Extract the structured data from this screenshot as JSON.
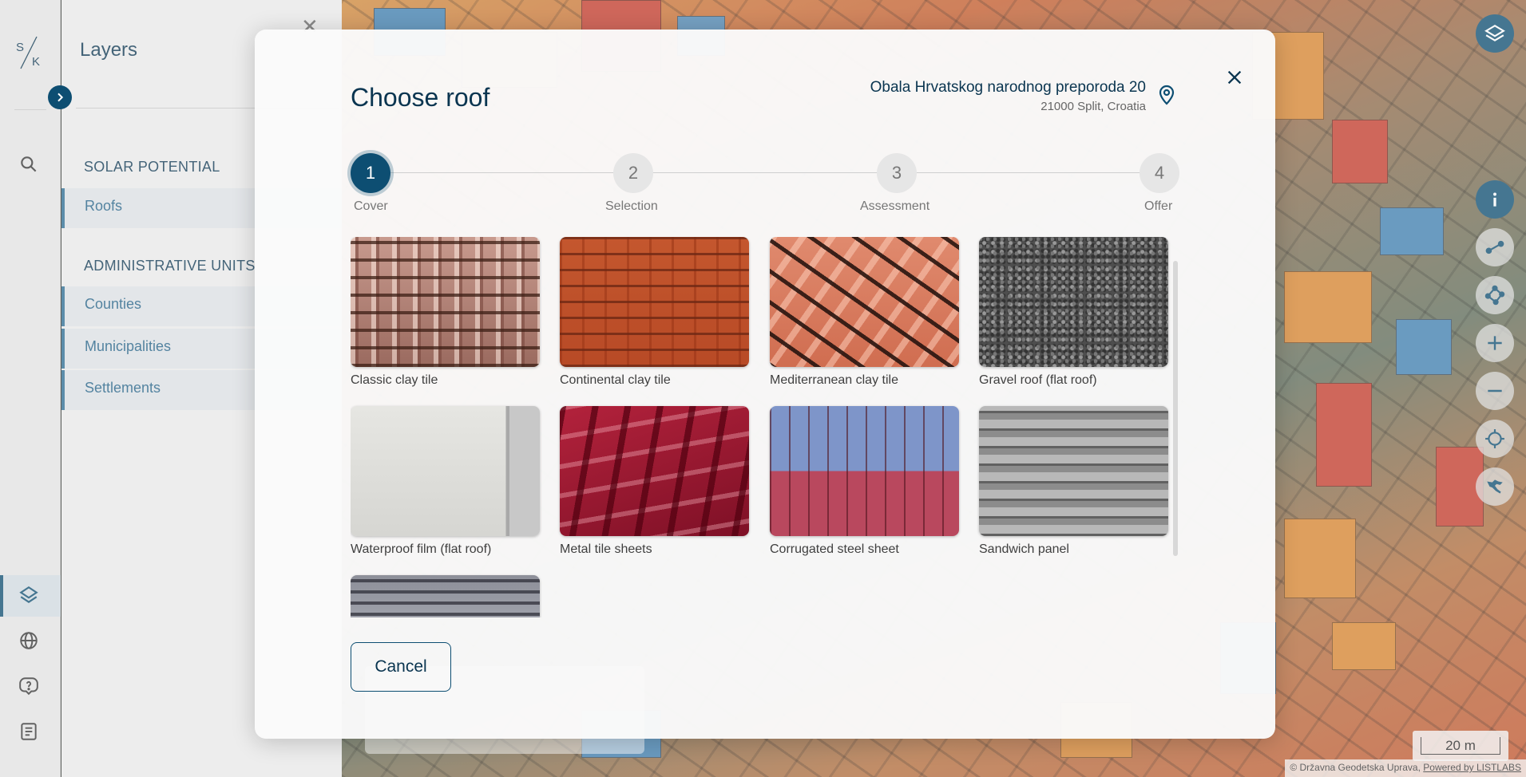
{
  "panel": {
    "title": "Layers",
    "sections": [
      {
        "title": "SOLAR POTENTIAL",
        "items": [
          "Roofs"
        ]
      },
      {
        "title": "ADMINISTRATIVE UNITS",
        "items": [
          "Counties",
          "Municipalities",
          "Settlements"
        ]
      }
    ]
  },
  "logo": {
    "text_top": "S",
    "text_bottom": "K"
  },
  "modal": {
    "title": "Choose roof",
    "address_line1": "Obala Hrvatskog narodnog preporoda 20",
    "address_line2": "21000 Split, Croatia",
    "steps": [
      {
        "number": "1",
        "label": "Cover",
        "active": true
      },
      {
        "number": "2",
        "label": "Selection",
        "active": false
      },
      {
        "number": "3",
        "label": "Assessment",
        "active": false
      },
      {
        "number": "4",
        "label": "Offer",
        "active": false
      }
    ],
    "roofs": [
      {
        "label": "Classic clay tile"
      },
      {
        "label": "Continental clay tile"
      },
      {
        "label": "Mediterranean clay tile"
      },
      {
        "label": "Gravel roof (flat roof)"
      },
      {
        "label": "Waterproof film (flat roof)"
      },
      {
        "label": "Metal tile sheets"
      },
      {
        "label": "Corrugated steel sheet"
      },
      {
        "label": "Sandwich panel"
      },
      {
        "label": ""
      }
    ],
    "cancel_label": "Cancel"
  },
  "map": {
    "scale_label": "20 m",
    "attribution_text": "© Državna Geodetska Uprava, ",
    "attribution_link": "Powered by LISTLABS"
  },
  "colors": {
    "primary": "#0d4e72",
    "roof_orange": "#d0893a",
    "roof_red": "#c4532b",
    "roof_blue": "#5b8fb5"
  }
}
